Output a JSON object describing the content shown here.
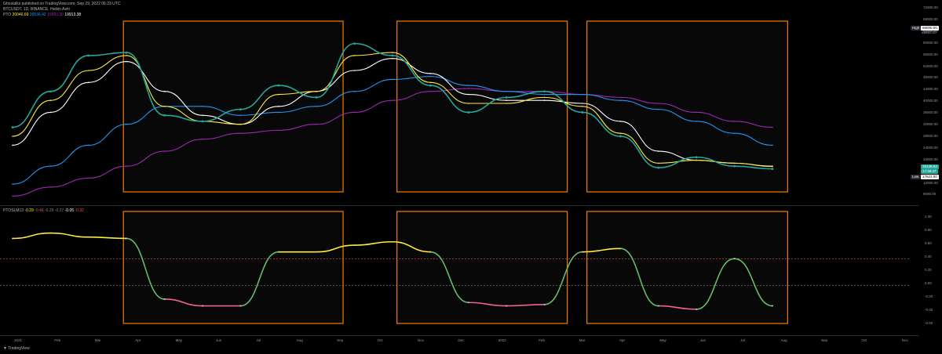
{
  "header": {
    "publisher": "Ghostalks published on TradingView.com, Sep 29, 2022 06:23 UTC",
    "symbol": "BTCUSDT, 1D, BINANCE, Heikin Ashi",
    "indicator_name": "PTO",
    "indicator_values": [
      "20046.69",
      "26536.42",
      "19893.30",
      "19913.38"
    ]
  },
  "oscillator_header": {
    "name": "PTOSLM13",
    "values": [
      "-0.29",
      "-0.46",
      "-0.29",
      "-0.27",
      "-0.05",
      "-0.32"
    ]
  },
  "price_axis": {
    "ticks": [
      "72000.00",
      "68000.00",
      "64000.00",
      "60000.00",
      "56000.00",
      "52000.00",
      "48000.00",
      "44000.00",
      "40000.00",
      "36000.00",
      "32000.00",
      "28000.00",
      "24000.00",
      "20000.00",
      "16000.00",
      "12000.00",
      "8000.00"
    ],
    "high_label": "High",
    "high_value": "69000.00",
    "high_sub": "68850.00",
    "last_value": "19138.93",
    "last_sub": "17:36:47",
    "low_label": "Low",
    "low_value": "17622.00"
  },
  "osc_axis": {
    "ticks": [
      "1.00",
      "0.80",
      "0.60",
      "0.40",
      "0.20",
      "0.00",
      "-0.20",
      "-0.40",
      "-0.60"
    ]
  },
  "time_axis": {
    "labels": [
      "2021",
      "Feb",
      "Mar",
      "Apr",
      "May",
      "Jun",
      "Jul",
      "Aug",
      "Sep",
      "Oct",
      "Nov",
      "Dec",
      "2022",
      "Feb",
      "Mar",
      "Apr",
      "May",
      "Jun",
      "Jul",
      "Aug",
      "Sep",
      "Oct",
      "Nov"
    ]
  },
  "footer": {
    "brand": "TradingView"
  },
  "colors": {
    "background": "#000000",
    "price_line": "#26a69a",
    "ema_fast": "#ffeb3b",
    "ema_slow": "#ffffff",
    "sma_long": "#2196f3",
    "sma_longest": "#9c27b0",
    "box": "#f57c00",
    "osc_neutral": "#c8c8c8"
  },
  "chart_data": {
    "type": "line",
    "x": [
      "2021-01",
      "2021-02",
      "2021-03",
      "2021-04",
      "2021-05",
      "2021-06",
      "2021-07",
      "2021-08",
      "2021-09",
      "2021-10",
      "2021-11",
      "2021-12",
      "2022-01",
      "2022-02",
      "2022-03",
      "2022-04",
      "2022-05",
      "2022-06",
      "2022-07",
      "2022-08",
      "2022-09"
    ],
    "series": [
      {
        "name": "price",
        "values": [
          33000,
          45000,
          57000,
          58000,
          37000,
          35000,
          39000,
          47000,
          43000,
          61000,
          57000,
          47000,
          38000,
          43000,
          45000,
          38000,
          30000,
          19500,
          23000,
          20000,
          19100
        ]
      },
      {
        "name": "ema_fast",
        "values": [
          30000,
          42000,
          52000,
          57000,
          40000,
          35000,
          34000,
          44000,
          45000,
          57000,
          58000,
          48000,
          41000,
          41000,
          43000,
          40000,
          31000,
          21000,
          22000,
          21000,
          19900
        ]
      },
      {
        "name": "ema_slow",
        "values": [
          27000,
          38000,
          48000,
          55000,
          45000,
          37000,
          34000,
          40000,
          45000,
          52000,
          56000,
          51000,
          44000,
          42000,
          42000,
          41000,
          35000,
          25000,
          22000,
          21000,
          20000
        ]
      },
      {
        "name": "sma_long",
        "values": [
          14000,
          20000,
          27000,
          34000,
          40000,
          40000,
          37000,
          38000,
          40000,
          45000,
          49000,
          50000,
          47000,
          45000,
          44000,
          44000,
          42000,
          39000,
          35000,
          31000,
          27000
        ]
      },
      {
        "name": "sma_longest",
        "values": [
          10000,
          13000,
          16000,
          20000,
          25000,
          29000,
          31000,
          32000,
          34000,
          38000,
          42000,
          45000,
          46000,
          45000,
          45000,
          44000,
          43000,
          41000,
          38000,
          35000,
          33000
        ]
      }
    ],
    "oscillator": {
      "name": "PTOSLM13",
      "values": [
        0.7,
        0.78,
        0.72,
        0.7,
        -0.2,
        -0.3,
        -0.3,
        0.5,
        0.5,
        0.6,
        0.65,
        0.5,
        -0.25,
        -0.3,
        -0.28,
        0.5,
        0.55,
        -0.3,
        -0.35,
        0.4,
        -0.3
      ]
    },
    "ylim": [
      8000,
      74000
    ],
    "osc_ylim": [
      -0.7,
      1.1
    ]
  }
}
